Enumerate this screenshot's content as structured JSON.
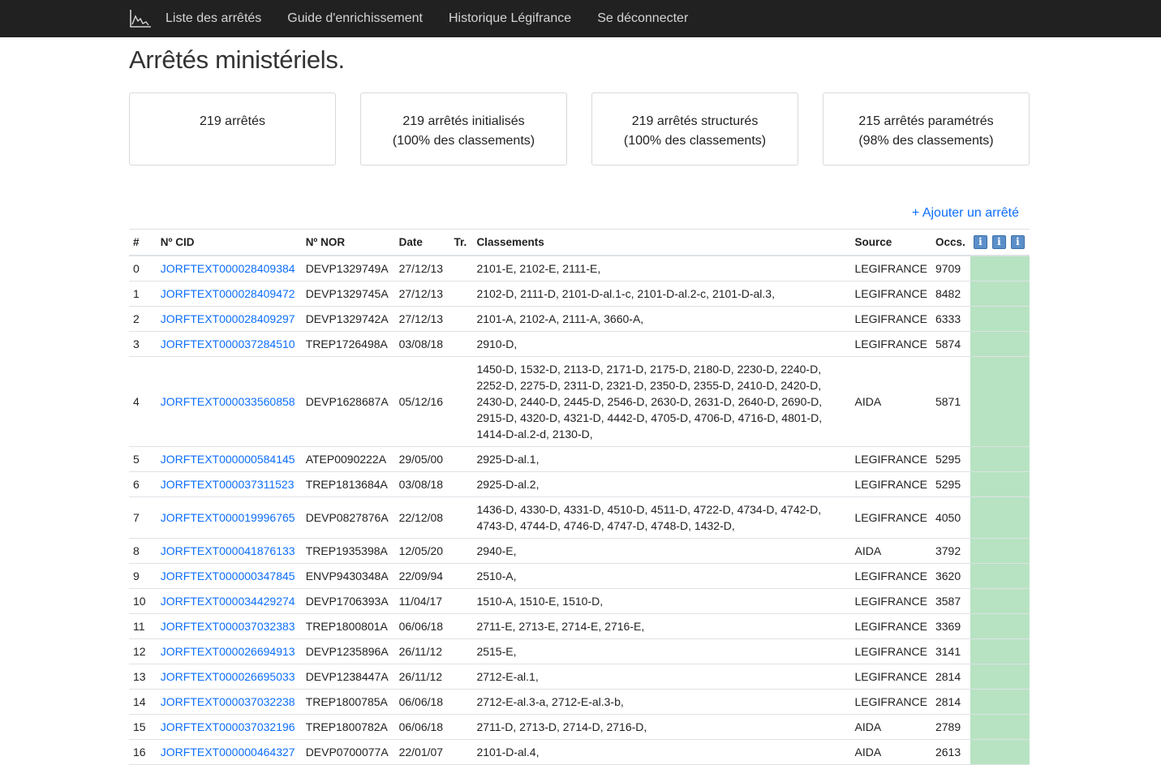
{
  "nav": {
    "logo_icon": "chart-logo-icon",
    "items": [
      {
        "label": "Liste des arrêtés"
      },
      {
        "label": "Guide d'enrichissement"
      },
      {
        "label": "Historique Légifrance"
      },
      {
        "label": "Se déconnecter"
      }
    ]
  },
  "page": {
    "title": "Arrêtés ministériels.",
    "add_link": "+ Ajouter un arrêté"
  },
  "cards": [
    {
      "line1": "219 arrêtés",
      "line2": ""
    },
    {
      "line1": "219 arrêtés initialisés",
      "line2": "(100% des classements)"
    },
    {
      "line1": "219 arrêtés structurés",
      "line2": "(100% des classements)"
    },
    {
      "line1": "215 arrêtés paramétrés",
      "line2": "(98% des classements)"
    }
  ],
  "table": {
    "headers": {
      "num": "#",
      "cid": "Nº CID",
      "nor": "Nº NOR",
      "date": "Date",
      "tr": "Tr.",
      "classements": "Classements",
      "source": "Source",
      "occs": "Occs."
    },
    "info_icons": [
      "info-icon",
      "info-icon",
      "info-icon"
    ],
    "status_color": "#b7e3c2",
    "rows": [
      {
        "num": "0",
        "cid": "JORFTEXT000028409384",
        "nor": "DEVP1329749A",
        "date": "27/12/13",
        "tr": "",
        "classements": "2101-E, 2102-E, 2111-E,",
        "source": "LEGIFRANCE",
        "occs": "9709"
      },
      {
        "num": "1",
        "cid": "JORFTEXT000028409472",
        "nor": "DEVP1329745A",
        "date": "27/12/13",
        "tr": "",
        "classements": "2102-D, 2111-D, 2101-D-al.1-c, 2101-D-al.2-c, 2101-D-al.3,",
        "source": "LEGIFRANCE",
        "occs": "8482"
      },
      {
        "num": "2",
        "cid": "JORFTEXT000028409297",
        "nor": "DEVP1329742A",
        "date": "27/12/13",
        "tr": "",
        "classements": "2101-A, 2102-A, 2111-A, 3660-A,",
        "source": "LEGIFRANCE",
        "occs": "6333"
      },
      {
        "num": "3",
        "cid": "JORFTEXT000037284510",
        "nor": "TREP1726498A",
        "date": "03/08/18",
        "tr": "",
        "classements": "2910-D,",
        "source": "LEGIFRANCE",
        "occs": "5874"
      },
      {
        "num": "4",
        "cid": "JORFTEXT000033560858",
        "nor": "DEVP1628687A",
        "date": "05/12/16",
        "tr": "",
        "classements": "1450-D, 1532-D, 2113-D, 2171-D, 2175-D, 2180-D, 2230-D, 2240-D, 2252-D, 2275-D, 2311-D, 2321-D, 2350-D, 2355-D, 2410-D, 2420-D, 2430-D, 2440-D, 2445-D, 2546-D, 2630-D, 2631-D, 2640-D, 2690-D, 2915-D, 4320-D, 4321-D, 4442-D, 4705-D, 4706-D, 4716-D, 4801-D, 1414-D-al.2-d, 2130-D,",
        "source": "AIDA",
        "occs": "5871"
      },
      {
        "num": "5",
        "cid": "JORFTEXT000000584145",
        "nor": "ATEP0090222A",
        "date": "29/05/00",
        "tr": "",
        "classements": "2925-D-al.1,",
        "source": "LEGIFRANCE",
        "occs": "5295"
      },
      {
        "num": "6",
        "cid": "JORFTEXT000037311523",
        "nor": "TREP1813684A",
        "date": "03/08/18",
        "tr": "",
        "classements": "2925-D-al.2,",
        "source": "LEGIFRANCE",
        "occs": "5295"
      },
      {
        "num": "7",
        "cid": "JORFTEXT000019996765",
        "nor": "DEVP0827876A",
        "date": "22/12/08",
        "tr": "",
        "classements": "1436-D, 4330-D, 4331-D, 4510-D, 4511-D, 4722-D, 4734-D, 4742-D, 4743-D, 4744-D, 4746-D, 4747-D, 4748-D, 1432-D,",
        "source": "LEGIFRANCE",
        "occs": "4050"
      },
      {
        "num": "8",
        "cid": "JORFTEXT000041876133",
        "nor": "TREP1935398A",
        "date": "12/05/20",
        "tr": "",
        "classements": "2940-E,",
        "source": "AIDA",
        "occs": "3792"
      },
      {
        "num": "9",
        "cid": "JORFTEXT000000347845",
        "nor": "ENVP9430348A",
        "date": "22/09/94",
        "tr": "",
        "classements": "2510-A,",
        "source": "LEGIFRANCE",
        "occs": "3620"
      },
      {
        "num": "10",
        "cid": "JORFTEXT000034429274",
        "nor": "DEVP1706393A",
        "date": "11/04/17",
        "tr": "",
        "classements": "1510-A, 1510-E, 1510-D,",
        "source": "LEGIFRANCE",
        "occs": "3587"
      },
      {
        "num": "11",
        "cid": "JORFTEXT000037032383",
        "nor": "TREP1800801A",
        "date": "06/06/18",
        "tr": "",
        "classements": "2711-E, 2713-E, 2714-E, 2716-E,",
        "source": "LEGIFRANCE",
        "occs": "3369"
      },
      {
        "num": "12",
        "cid": "JORFTEXT000026694913",
        "nor": "DEVP1235896A",
        "date": "26/11/12",
        "tr": "",
        "classements": "2515-E,",
        "source": "LEGIFRANCE",
        "occs": "3141"
      },
      {
        "num": "13",
        "cid": "JORFTEXT000026695033",
        "nor": "DEVP1238447A",
        "date": "26/11/12",
        "tr": "",
        "classements": "2712-E-al.1,",
        "source": "LEGIFRANCE",
        "occs": "2814"
      },
      {
        "num": "14",
        "cid": "JORFTEXT000037032238",
        "nor": "TREP1800785A",
        "date": "06/06/18",
        "tr": "",
        "classements": "2712-E-al.3-a, 2712-E-al.3-b,",
        "source": "LEGIFRANCE",
        "occs": "2814"
      },
      {
        "num": "15",
        "cid": "JORFTEXT000037032196",
        "nor": "TREP1800782A",
        "date": "06/06/18",
        "tr": "",
        "classements": "2711-D, 2713-D, 2714-D, 2716-D,",
        "source": "AIDA",
        "occs": "2789"
      },
      {
        "num": "16",
        "cid": "JORFTEXT000000464327",
        "nor": "DEVP0700077A",
        "date": "22/01/07",
        "tr": "",
        "classements": "2101-D-al.4,",
        "source": "AIDA",
        "occs": "2613"
      }
    ]
  }
}
